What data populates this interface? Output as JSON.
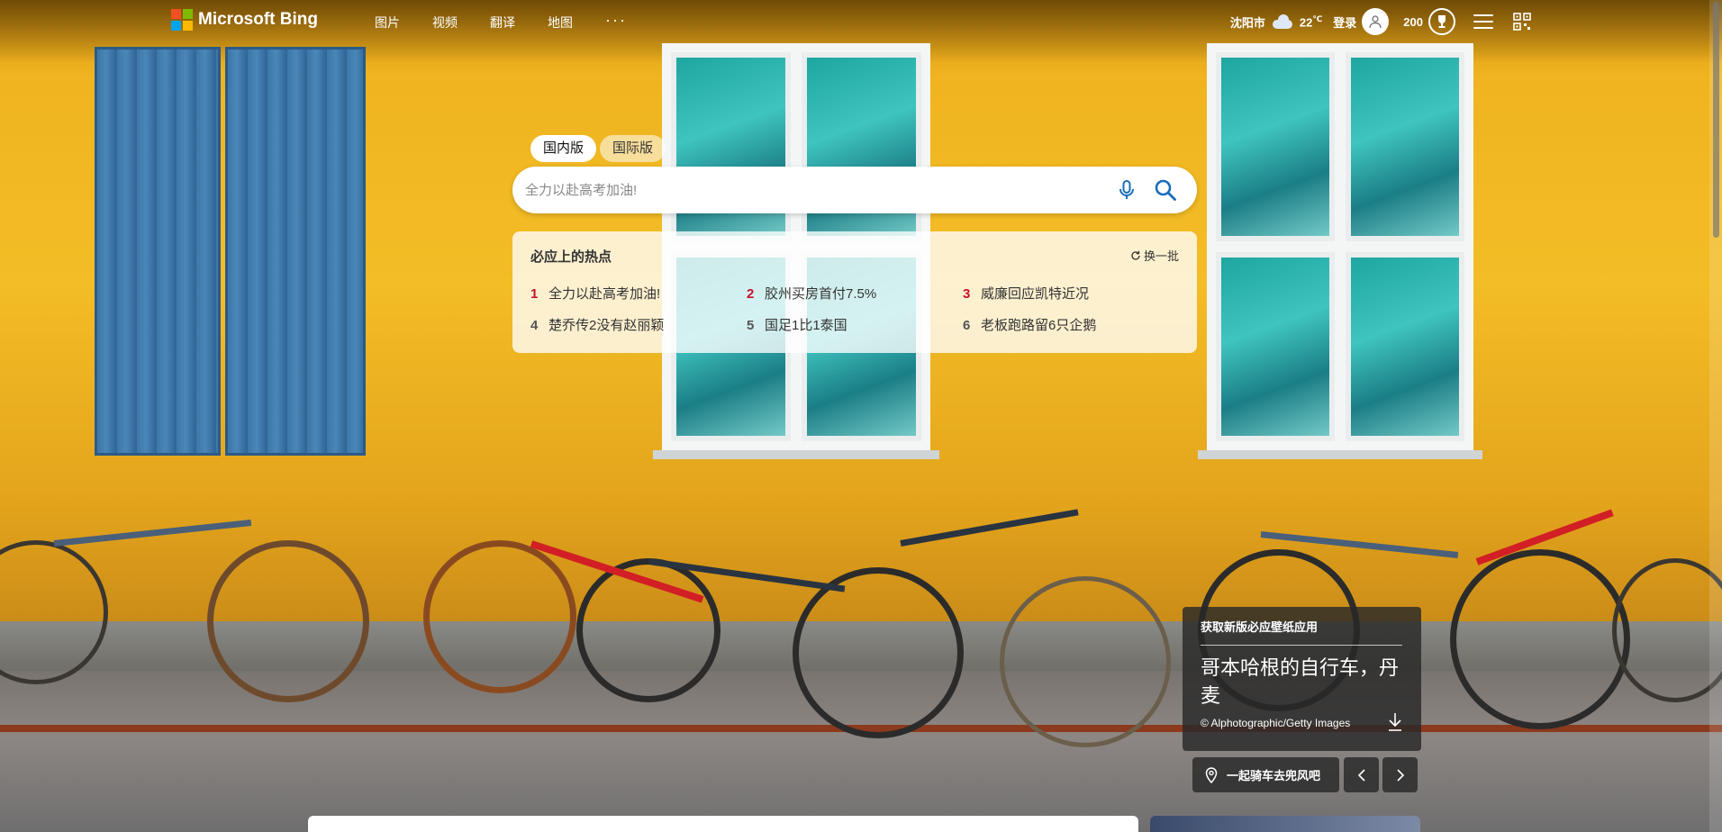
{
  "header": {
    "brand": "Microsoft Bing",
    "nav": [
      "图片",
      "视频",
      "翻译",
      "地图"
    ],
    "more": "···",
    "city": "沈阳市",
    "temperature": "22",
    "temperature_unit": "℃",
    "login": "登录",
    "points": "200"
  },
  "search": {
    "tab_domestic": "国内版",
    "tab_international": "国际版",
    "placeholder": "全力以赴高考加油!"
  },
  "trending": {
    "title": "必应上的热点",
    "refresh": "换一批",
    "items": [
      {
        "rank": "1",
        "text": "全力以赴高考加油!"
      },
      {
        "rank": "2",
        "text": "胶州买房首付7.5%"
      },
      {
        "rank": "3",
        "text": "威廉回应凯特近况"
      },
      {
        "rank": "4",
        "text": "楚乔传2没有赵丽颖"
      },
      {
        "rank": "5",
        "text": "国足1比1泰国"
      },
      {
        "rank": "6",
        "text": "老板跑路留6只企鹅"
      }
    ]
  },
  "wallpaper": {
    "promo": "获取新版必应壁纸应用",
    "title": "哥本哈根的自行车，丹麦",
    "credit": "© Alphotographic/Getty Images",
    "location_hint": "一起骑车去兜风吧"
  },
  "colors": {
    "hot_rank": "#c8102e",
    "wall_yellow": "#f3bd26"
  }
}
